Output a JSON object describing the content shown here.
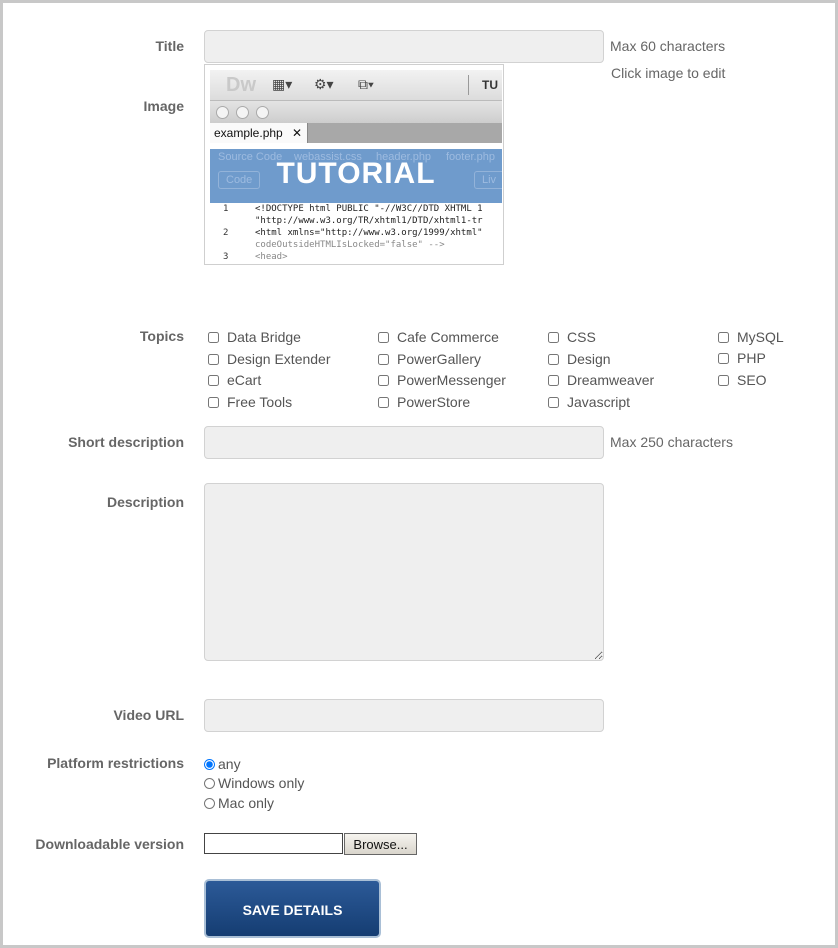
{
  "form": {
    "title": {
      "label": "Title",
      "value": "",
      "hint": "Max 60 characters"
    },
    "image": {
      "label": "Image",
      "hint": "Click image to edit",
      "preview": {
        "logo": "Dw",
        "toolbar_right": "TU",
        "tab": "example.php",
        "tab_close": "✕",
        "related_files": [
          "Source Code",
          "webassist.css",
          "header.php",
          "footer.php"
        ],
        "view_buttons": [
          "Code",
          "Liv"
        ],
        "overlay_text": "TUTORIAL",
        "code": [
          {
            "num": "1",
            "text": "<!DOCTYPE html PUBLIC \"-//W3C//DTD XHTML 1"
          },
          {
            "num": "",
            "text": "\"http://www.w3.org/TR/xhtml1/DTD/xhtml1-tr"
          },
          {
            "num": "2",
            "text": "<html xmlns=\"http://www.w3.org/1999/xhtml\""
          },
          {
            "num": "",
            "text": "codeOutsideHTMLIsLocked=\"false\" -->"
          },
          {
            "num": "3",
            "text": "<head>"
          }
        ]
      }
    },
    "topics": {
      "label": "Topics",
      "columns": [
        [
          "Data Bridge",
          "Design Extender",
          "eCart",
          "Free Tools"
        ],
        [
          "Cafe Commerce",
          "PowerGallery",
          "PowerMessenger",
          "PowerStore"
        ],
        [
          "CSS",
          "Design",
          "Dreamweaver",
          "Javascript"
        ],
        [
          "MySQL",
          "PHP",
          "SEO"
        ]
      ]
    },
    "short_description": {
      "label": "Short description",
      "value": "",
      "hint": "Max 250 characters"
    },
    "description": {
      "label": "Description",
      "value": ""
    },
    "video_url": {
      "label": "Video URL",
      "value": ""
    },
    "platform": {
      "label": "Platform restrictions",
      "options": [
        "any",
        "Windows only",
        "Mac only"
      ],
      "selected": "any"
    },
    "download": {
      "label": "Downloadable version",
      "file": "",
      "browse_label": "Browse..."
    },
    "save_label": "SAVE DETAILS"
  }
}
